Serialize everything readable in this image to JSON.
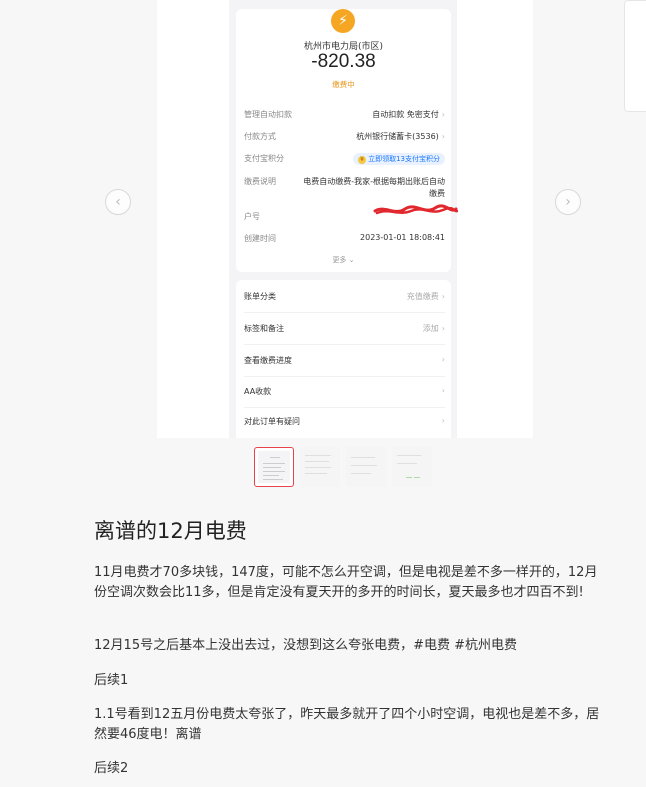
{
  "receipt": {
    "merchant": "杭州市电力局(市区)",
    "amount": "-820.38",
    "status": "缴费中",
    "rows": [
      {
        "key": "管理自动扣款",
        "value": "自动扣款 免密支付"
      },
      {
        "key": "付款方式",
        "value": "杭州银行储蓄卡(3536)"
      },
      {
        "key": "支付宝积分",
        "value": "立即领取13支付宝积分"
      },
      {
        "key": "缴费说明",
        "value": "电费自动缴费-我家-根据每期出账后自动缴费"
      },
      {
        "key": "户号",
        "value": ""
      },
      {
        "key": "创建时间",
        "value": "2023-01-01 18:08:41"
      }
    ],
    "more": "更多",
    "options": [
      {
        "key": "账单分类",
        "value": "充值缴费"
      },
      {
        "key": "标签和备注",
        "value": "添加"
      },
      {
        "key": "查看缴费进度",
        "value": ""
      },
      {
        "key": "AA收款",
        "value": ""
      },
      {
        "key": "对此订单有疑问",
        "value": ""
      }
    ]
  },
  "icons": {
    "merchant": "lightning-icon",
    "prev": "chevron-left-icon",
    "next": "chevron-right-icon"
  },
  "colors": {
    "status": "#e8961c",
    "active_thumb": "#e8424a",
    "link": "#1677ff"
  },
  "article": {
    "title": "离谱的12月电费",
    "paragraphs": [
      "11月电费才70多块钱，147度，可能不怎么开空调，但是电视是差不多一样开的，12月份空调次数会比11多，但是肯定没有夏天开的多开的时间长，夏天最多也才四百不到!",
      "12月15号之后基本上没出去过，没想到这么夸张电费，#电费 #杭州电费",
      "后续1",
      "1.1号看到12五月份电费太夸张了，昨天最多就开了四个小时空调，电视也是差不多，居然要46度电！离谱",
      "后续2"
    ]
  }
}
